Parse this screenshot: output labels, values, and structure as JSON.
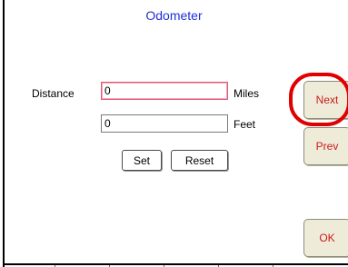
{
  "window": {
    "title": "Odometer"
  },
  "form": {
    "distance_label": "Distance",
    "miles_value": "0",
    "miles_unit": "Miles",
    "feet_value": "0",
    "feet_unit": "Feet"
  },
  "buttons": {
    "set_label": "Set",
    "reset_label": "Reset"
  },
  "side_buttons": {
    "next_label": "Next",
    "prev_label": "Prev",
    "ok_label": "OK"
  },
  "colors": {
    "title_text": "#1f2fd6",
    "side_button_text": "#cc1a1a",
    "side_button_background": "#eeecd9",
    "active_field_border": "#e25a76",
    "highlight_ring": "#e00000"
  }
}
